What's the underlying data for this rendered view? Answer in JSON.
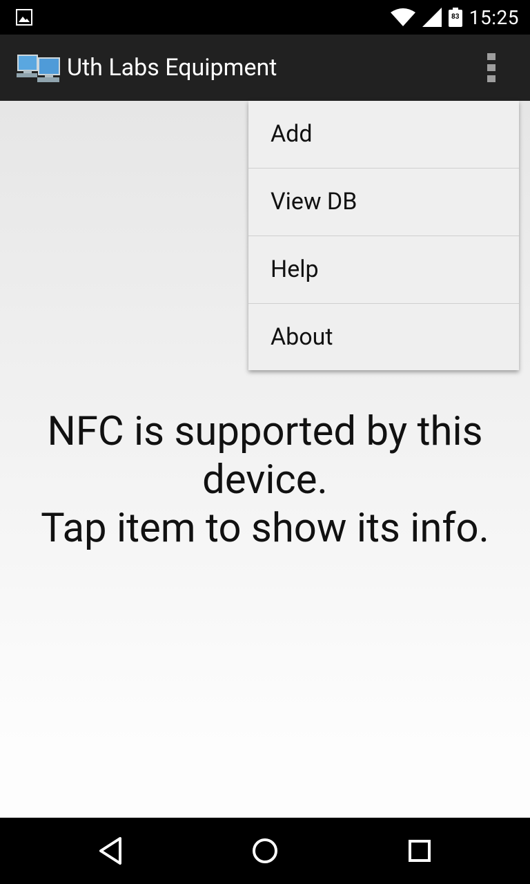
{
  "status_bar": {
    "time": "15:25",
    "battery": "83"
  },
  "app_bar": {
    "title": "Uth Labs Equipment",
    "overflow_icon": "more-vert-icon"
  },
  "main": {
    "message_lines": [
      "NFC is supported by this",
      "device.",
      "Tap item to show its info."
    ]
  },
  "menu": {
    "items": [
      "Add",
      "View DB",
      "Help",
      "About"
    ]
  },
  "nav_bar": {
    "icons": [
      "back-icon",
      "home-icon",
      "recents-icon"
    ]
  }
}
